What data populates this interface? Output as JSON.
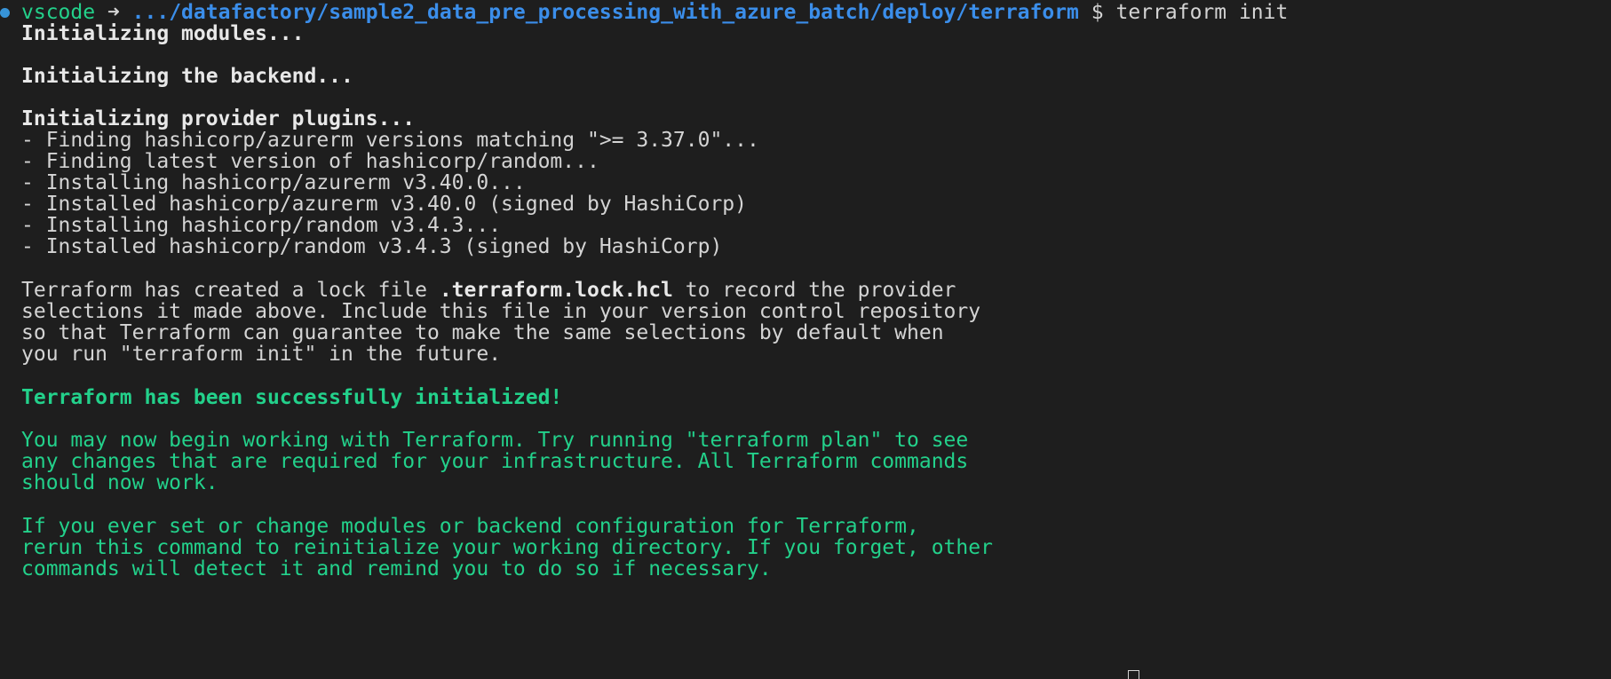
{
  "prompt": {
    "user": "vscode",
    "arrow": "➜",
    "path": ".../datafactory/sample2_data_pre_processing_with_azure_batch/deploy/terraform",
    "symbol": "$",
    "command": "terraform init"
  },
  "output": {
    "init_modules": "Initializing modules...",
    "init_backend": "Initializing the backend...",
    "init_plugins": "Initializing provider plugins...",
    "plugin_lines": [
      "- Finding hashicorp/azurerm versions matching \">= 3.37.0\"...",
      "- Finding latest version of hashicorp/random...",
      "- Installing hashicorp/azurerm v3.40.0...",
      "- Installed hashicorp/azurerm v3.40.0 (signed by HashiCorp)",
      "- Installing hashicorp/random v3.4.3...",
      "- Installed hashicorp/random v3.4.3 (signed by HashiCorp)"
    ],
    "lock_line1_pre": "Terraform has created a lock file ",
    "lock_file": ".terraform.lock.hcl",
    "lock_line1_post": " to record the provider",
    "lock_lines": [
      "selections it made above. Include this file in your version control repository",
      "so that Terraform can guarantee to make the same selections by default when",
      "you run \"terraform init\" in the future."
    ],
    "success": "Terraform has been successfully initialized!",
    "begin_lines": [
      "You may now begin working with Terraform. Try running \"terraform plan\" to see",
      "any changes that are required for your infrastructure. All Terraform commands",
      "should now work."
    ],
    "rerun_lines": [
      "If you ever set or change modules or backend configuration for Terraform,",
      "rerun this command to reinitialize your working directory. If you forget, other",
      "commands will detect it and remind you to do so if necessary."
    ]
  },
  "colors": {
    "background": "#1e1e1e",
    "text": "#d4d4d4",
    "green": "#23d18b",
    "path_blue": "#3b8eea",
    "status_dot": "#3794d8"
  }
}
